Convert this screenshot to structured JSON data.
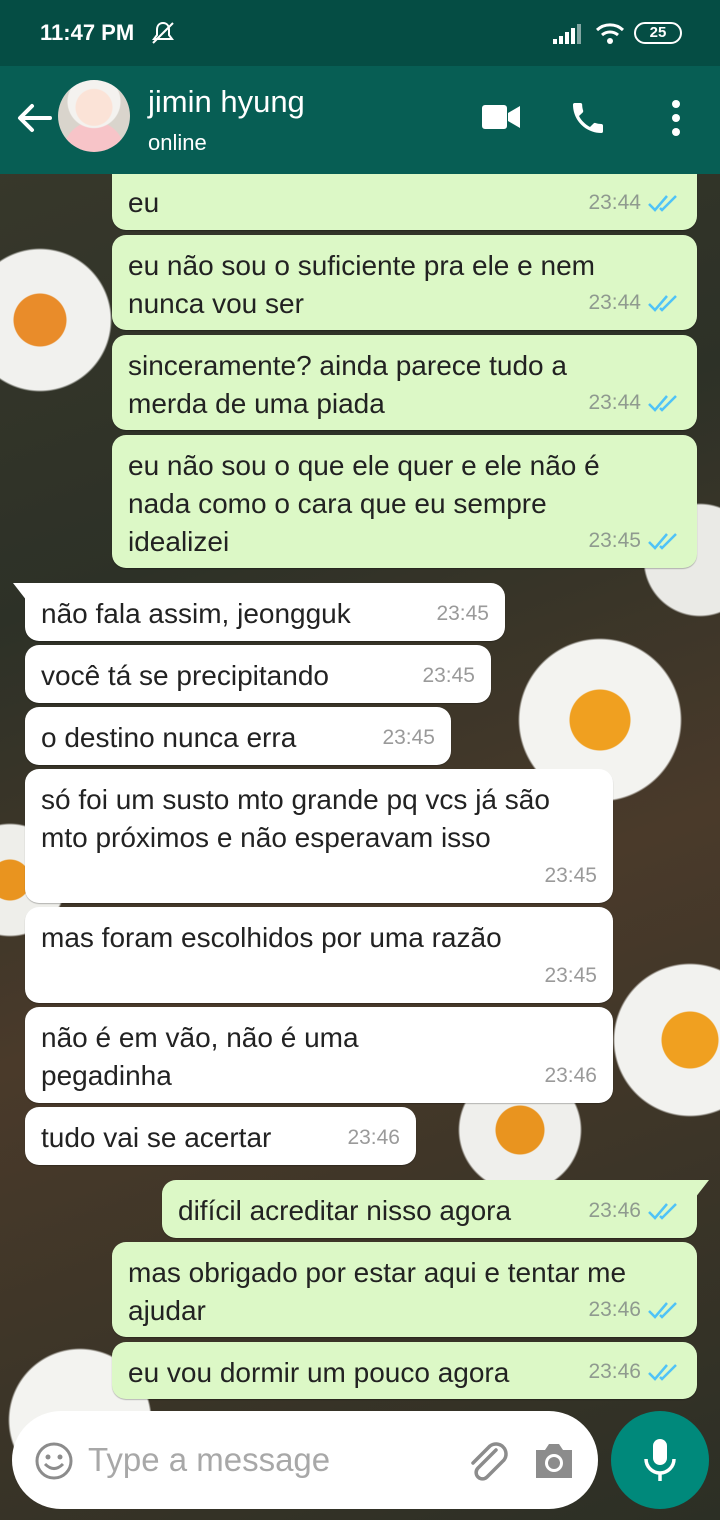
{
  "status_bar": {
    "time": "11:47 PM",
    "battery": "25"
  },
  "header": {
    "contact_name": "jimin hyung",
    "contact_status": "online"
  },
  "messages": [
    {
      "dir": "out",
      "text": "eu",
      "time": "23:44"
    },
    {
      "dir": "out",
      "text": "eu não sou o suficiente pra ele e nem nunca vou ser",
      "time": "23:44"
    },
    {
      "dir": "out",
      "text": "sinceramente? ainda parece tudo a merda de uma piada",
      "time": "23:44"
    },
    {
      "dir": "out",
      "text": "eu não sou o que ele quer e ele não é nada como o cara que eu sempre idealizei",
      "time": "23:45"
    },
    {
      "dir": "in",
      "text": "não fala assim, jeongguk",
      "time": "23:45"
    },
    {
      "dir": "in",
      "text": "você tá se precipitando",
      "time": "23:45"
    },
    {
      "dir": "in",
      "text": "o destino nunca erra",
      "time": "23:45"
    },
    {
      "dir": "in",
      "text": "só foi um susto mto grande pq vcs já são mto próximos e não esperavam isso",
      "time": "23:45"
    },
    {
      "dir": "in",
      "text": "mas foram escolhidos por uma razão",
      "time": "23:45"
    },
    {
      "dir": "in",
      "text": "não é em vão, não é uma pegadinha",
      "time": "23:46"
    },
    {
      "dir": "in",
      "text": "tudo vai se acertar",
      "time": "23:46"
    },
    {
      "dir": "out",
      "text": "difícil acreditar nisso agora",
      "time": "23:46"
    },
    {
      "dir": "out",
      "text": "mas obrigado por estar aqui e tentar me ajudar",
      "time": "23:46"
    },
    {
      "dir": "out",
      "text": "eu vou dormir um pouco agora",
      "time": "23:46"
    }
  ],
  "composer": {
    "placeholder": "Type a message"
  },
  "colors": {
    "header": "#075e54",
    "status_bar": "#054d44",
    "outgoing_bubble": "#dcf8c6",
    "incoming_bubble": "#ffffff",
    "read_tick": "#4fc3f7",
    "mic_button": "#00897b"
  }
}
